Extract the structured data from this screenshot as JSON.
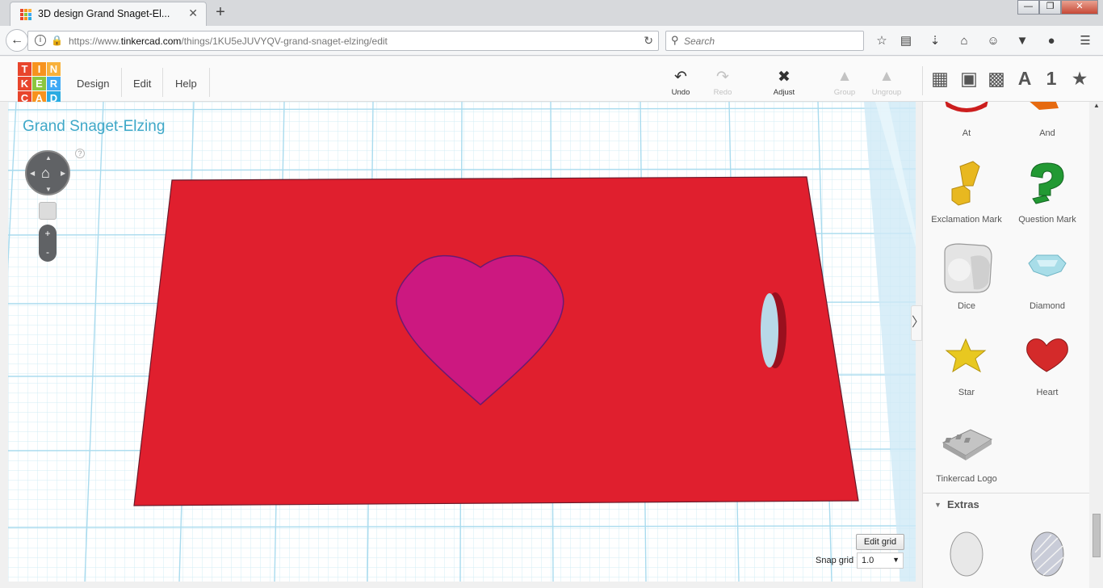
{
  "browser": {
    "tab_title": "3D design Grand Snaget-El...",
    "tab_close": "✕",
    "new_tab": "+",
    "url_prefix": "https://www.",
    "url_domain": "tinkercad.com",
    "url_path": "/things/1KU5eJUVYQV-grand-snaget-elzing/edit",
    "search_placeholder": "Search",
    "window_buttons": {
      "minimize": "—",
      "maximize": "❐",
      "close": "✕"
    }
  },
  "app": {
    "logo_letters": [
      "T",
      "I",
      "N",
      "K",
      "E",
      "R",
      "C",
      "A",
      "D"
    ],
    "logo_colors": [
      "#e8452c",
      "#f7931e",
      "#fbb03b",
      "#e8452c",
      "#8cc63f",
      "#3fa9f5",
      "#e8452c",
      "#f7931e",
      "#29abe2"
    ],
    "menu": [
      "Design",
      "Edit",
      "Help"
    ],
    "toolbar": {
      "undo": "Undo",
      "redo": "Redo",
      "adjust": "Adjust",
      "group": "Group",
      "ungroup": "Ungroup"
    },
    "view_icons": [
      "grid-view-icon",
      "box-view-icon",
      "wireframe-view-icon",
      "text-letter-icon",
      "number-icon",
      "favorites-star-icon"
    ],
    "view_glyph_a": "A",
    "view_glyph_1": "1"
  },
  "workplane": {
    "design_name": "Grand Snaget-Elzing",
    "help": "?",
    "zoom_in": "+",
    "zoom_out": "-",
    "edit_grid": "Edit grid",
    "snap_grid_label": "Snap grid",
    "snap_grid_value": "1.0",
    "colors": {
      "plate": "#e01f2e",
      "heart": "#cc1880",
      "grid_line": "#a9dbee"
    }
  },
  "sidepanel": {
    "shapes": [
      {
        "label": "At",
        "color": "#cc1e1e"
      },
      {
        "label": "And",
        "color": "#e66a10"
      },
      {
        "label": "Exclamation Mark",
        "color": "#e8b820"
      },
      {
        "label": "Question Mark",
        "color": "#229933"
      },
      {
        "label": "Dice",
        "color": "#dcdcdc"
      },
      {
        "label": "Diamond",
        "color": "#a8dde8"
      },
      {
        "label": "Star",
        "color": "#e8c820"
      },
      {
        "label": "Heart",
        "color": "#d42a2a"
      },
      {
        "label": "Tinkercad Logo",
        "color": "#b5b5b5"
      }
    ],
    "extras_label": "Extras",
    "collapse_arrow": "〉"
  }
}
